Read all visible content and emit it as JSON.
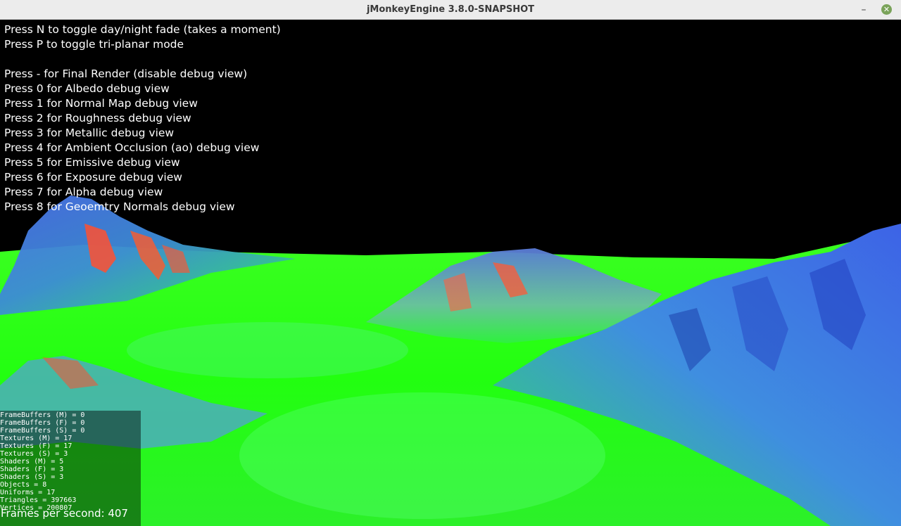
{
  "window": {
    "title": "jMonkeyEngine 3.8.0-SNAPSHOT",
    "minimize_glyph": "–",
    "close_glyph": "✕"
  },
  "help": {
    "lines": [
      "Press N to toggle day/night fade (takes a moment)",
      "Press P to toggle tri-planar mode",
      "",
      "Press - for Final Render (disable debug view)",
      "Press 0 for Albedo debug view",
      "Press 1 for Normal Map debug view",
      "Press 2 for Roughness debug view",
      "Press 3 for Metallic debug view",
      "Press 4 for Ambient Occlusion (ao) debug view",
      "Press 5 for Emissive debug view",
      "Press 6 for Exposure debug view",
      "Press 7 for Alpha debug view",
      "Press 8 for Geoemtry Normals debug view"
    ]
  },
  "stats": {
    "rows": [
      "FrameBuffers (M) = 0",
      "FrameBuffers (F) = 0",
      "FrameBuffers (S) = 0",
      "Textures (M) = 17",
      "Textures (F) = 17",
      "Textures (S) = 3",
      "Shaders (M) = 5",
      "Shaders (F) = 3",
      "Shaders (S) = 3",
      "Objects = 8",
      "Uniforms = 17",
      "Triangles = 397663",
      "Vertices = 200807"
    ],
    "fps": "Frames per second: 407"
  },
  "colors": {
    "sky": "#000000",
    "terrain_green": "#22ff10",
    "terrain_blue": "#3a6fe0",
    "terrain_red": "#ff4a2a"
  }
}
